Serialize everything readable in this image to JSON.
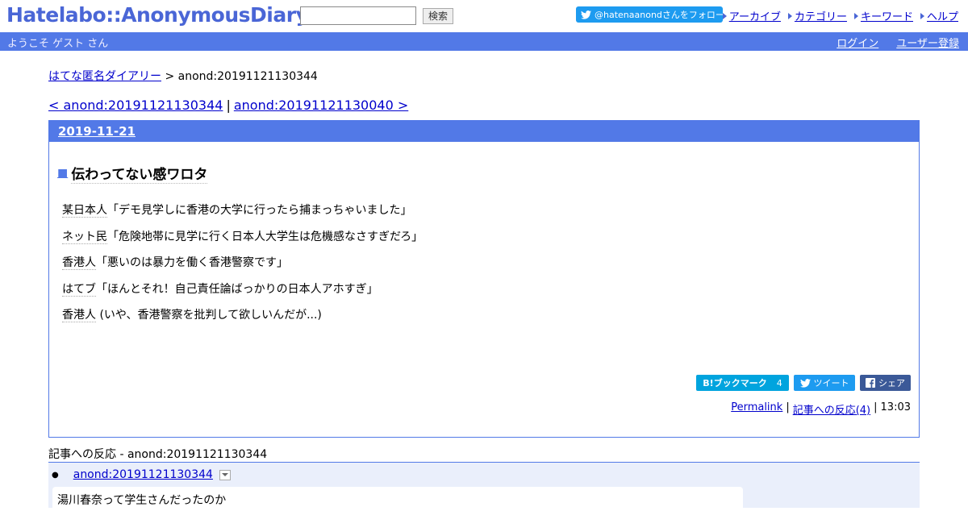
{
  "header": {
    "logo": "Hatelabo::AnonymousDiary",
    "search_placeholder": "",
    "search_button": "検索",
    "follow_button": "@hatenaanondさんをフォロー",
    "nav": [
      {
        "label": "アーカイブ"
      },
      {
        "label": "カテゴリー"
      },
      {
        "label": "キーワード"
      },
      {
        "label": "ヘルプ"
      }
    ]
  },
  "welcome": {
    "text": "ようこそ ゲスト さん",
    "login": "ログイン",
    "register": "ユーザー登録"
  },
  "breadcrumb": {
    "home": "はてな匿名ダイアリー",
    "separator": ">",
    "current": "anond:20191121130344"
  },
  "prevnext": {
    "prev": "< anond:20191121130344",
    "separator": "|",
    "next": "anond:20191121130040 >"
  },
  "day": {
    "date": "2019-11-21",
    "entry": {
      "marker": "■",
      "title": "伝わってない感ワロタ",
      "lines": [
        {
          "speaker": "某日本人",
          "text": "「デモ見学しに香港の大学に行ったら捕まっちゃいました」"
        },
        {
          "speaker": "ネット民",
          "text": "「危険地帯に見学に行く日本人大学生は危機感なさすぎだろ」"
        },
        {
          "speaker": "香港人",
          "text": "「悪いのは暴力を働く香港警察です」"
        },
        {
          "speaker": "はてブ",
          "text": "「ほんとそれ！自己責任論ばっかりの日本人アホすぎ」"
        },
        {
          "speaker": "香港人",
          "text": " (いや、香港警察を批判して欲しいんだが...)"
        }
      ],
      "share": {
        "hatena_label": "B!ブックマーク",
        "hatena_count": "4",
        "tweet": "ツイート",
        "share": "シェア"
      },
      "footer": {
        "permalink": "Permalink",
        "sep1": "|",
        "reactions_link": "記事への反応(4)",
        "sep2": "|",
        "time": "13:03"
      }
    }
  },
  "reactions": {
    "title": "記事への反応 - anond:20191121130344",
    "items": [
      {
        "id": "anond:20191121130344",
        "text": "湯川春奈って学生さんだったのか"
      }
    ]
  },
  "colors": {
    "accent": "#5279e7",
    "logo": "#4a66d6",
    "twitter": "#1d9bf0",
    "hatena": "#00a4de",
    "facebook": "#3b5998",
    "reaction_bg": "#eaeffb"
  }
}
